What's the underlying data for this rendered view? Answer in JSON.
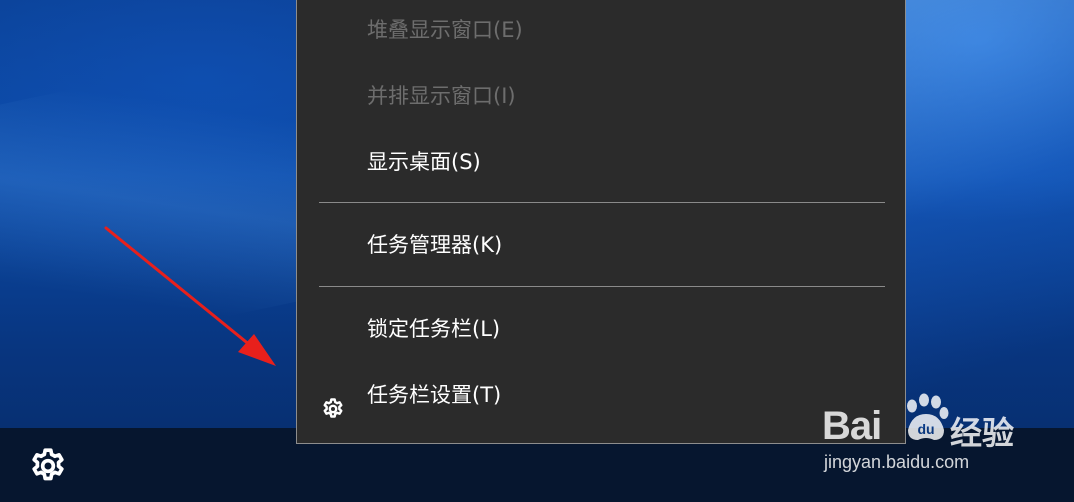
{
  "context_menu": {
    "items": [
      {
        "label": "堆叠显示窗口(E)",
        "enabled": false
      },
      {
        "label": "并排显示窗口(I)",
        "enabled": false
      },
      {
        "label": "显示桌面(S)",
        "enabled": true
      },
      {
        "label": "任务管理器(K)",
        "enabled": true
      },
      {
        "label": "锁定任务栏(L)",
        "enabled": true
      },
      {
        "label": "任务栏设置(T)",
        "enabled": true,
        "icon": "gear-icon"
      }
    ]
  },
  "taskbar": {
    "icon": "gear-icon"
  },
  "annotation": {
    "arrow_color": "#e8201c"
  },
  "watermark": {
    "brand_pre": "Bai",
    "brand_post": "经验",
    "url": "jingyan.baidu.com",
    "paw_text": "du"
  },
  "colors": {
    "menu_bg": "#2b2b2b",
    "menu_text": "#ffffff",
    "menu_disabled_text": "#6d6d6d",
    "taskbar_bg": "#06162f"
  }
}
